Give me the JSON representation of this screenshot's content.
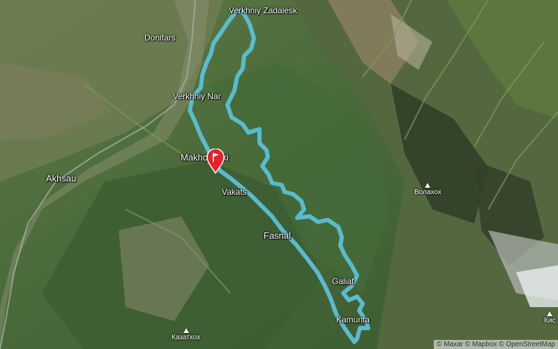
{
  "map": {
    "type": "satellite-terrain",
    "route_color": "#5bc0d6",
    "marker_color": "#e8202a"
  },
  "places": {
    "verkhniy_zadalesk": "Verkhniy Zadalesk",
    "donifars": "Donifars",
    "verkhniy_nar": "Verkhniy Nar",
    "makhcheski": "Makhcheski",
    "akhsau": "Akhsau",
    "vakats": "Vakats",
    "fasnal": "Fasnal",
    "galiat": "Galiat",
    "kamunta": "Kamunta",
    "volakhokh": "Волахох",
    "kazatkhokh": "Казатхох",
    "kis": "Кис"
  },
  "attribution": "© Maxar © Mapbox © OpenStreetMap"
}
